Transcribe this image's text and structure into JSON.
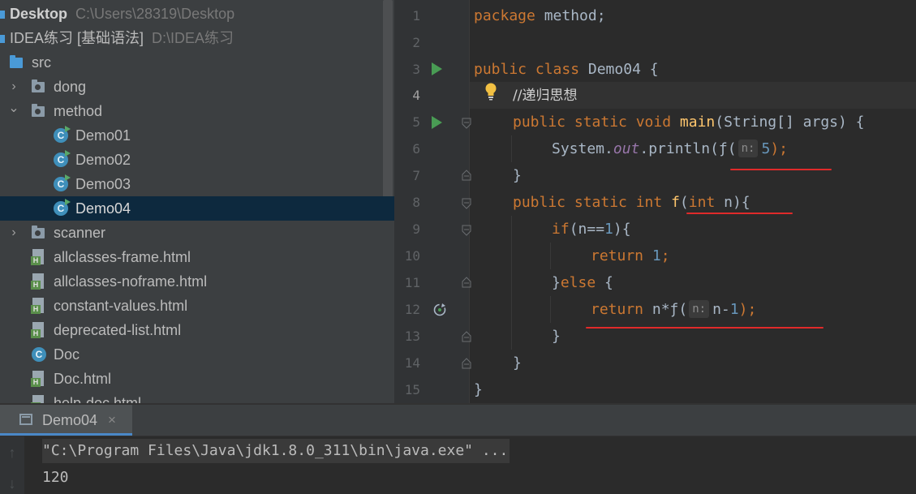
{
  "project_tree": {
    "rows": [
      {
        "label": "Desktop",
        "path": "C:\\Users\\28319\\Desktop"
      },
      {
        "label": "IDEA练习 [基础语法]",
        "path": "D:\\IDEA练习"
      },
      {
        "label": "src",
        "icon": "source-folder-icon"
      },
      {
        "label": "dong",
        "icon": "package-icon"
      },
      {
        "label": "method",
        "icon": "package-icon"
      },
      {
        "label": "Demo01",
        "icon": "java-class-icon"
      },
      {
        "label": "Demo02",
        "icon": "java-class-icon"
      },
      {
        "label": "Demo03",
        "icon": "java-class-icon"
      },
      {
        "label": "Demo04",
        "icon": "java-class-icon",
        "selected": true
      },
      {
        "label": "scanner",
        "icon": "package-icon"
      },
      {
        "label": "allclasses-frame.html",
        "icon": "html-file-icon"
      },
      {
        "label": "allclasses-noframe.html",
        "icon": "html-file-icon"
      },
      {
        "label": "constant-values.html",
        "icon": "html-file-icon"
      },
      {
        "label": "deprecated-list.html",
        "icon": "html-file-icon"
      },
      {
        "label": "Doc",
        "icon": "java-class-icon"
      },
      {
        "label": "Doc.html",
        "icon": "html-file-icon"
      },
      {
        "label": "help-doc.html",
        "icon": "html-file-icon"
      }
    ],
    "class_icon_letter": "C",
    "html_icon_letter": "H",
    "expand_arrow": "›",
    "collapse_arrow": "⌄"
  },
  "editor": {
    "line_numbers": [
      "1",
      "2",
      "3",
      "4",
      "5",
      "6",
      "7",
      "8",
      "9",
      "10",
      "11",
      "12",
      "13",
      "14",
      "15"
    ],
    "current_line": "4",
    "tokens": {
      "l1_kw": "package",
      "l1_rest": " method;",
      "l3_kw": "public class",
      "l3_rest": " Demo04 {",
      "l4_cmt": "//递归思想",
      "l5_kw": "public static void",
      "l5_fn": "main",
      "l5_rest": "(String[] args) {",
      "l6_a": "System.",
      "l6_out": "out",
      "l6_b": ".println(",
      "l6_f": "ƒ(",
      "l6_hint": "n:",
      "l6_num": "5",
      "l6_end": ");",
      "l7": "}",
      "l8_kw": "public static int",
      "l8_fn": "f",
      "l8_p": "(",
      "l8_kw2": "int",
      "l8_rest": " n){",
      "l9_kw": "if",
      "l9_a": "(n==",
      "l9_num": "1",
      "l9_b": "){",
      "l10_kw": "return",
      "l10_num": "1",
      "l10_end": ";",
      "l11_a": "}",
      "l11_kw": "else",
      "l11_b": " {",
      "l12_kw": "return",
      "l12_a": " n*",
      "l12_f": "ƒ(",
      "l12_hint": "n:",
      "l12_b": "n-",
      "l12_num": "1",
      "l12_end": ");",
      "l13": "}",
      "l14": "}",
      "l15": "}"
    }
  },
  "run_panel": {
    "tab_label": "Demo04",
    "tab_close": "×",
    "console_lines": [
      "\"C:\\Program Files\\Java\\jdk1.8.0_311\\bin\\java.exe\" ...",
      "120"
    ],
    "up_arrow": "↑",
    "down_arrow": "↓"
  },
  "colors": {
    "keyword": "#cc7832",
    "function": "#ffc66d",
    "number": "#6897bb",
    "static_field": "#9876aa",
    "annotation_underline": "#e02a2a",
    "selection": "#0d293e"
  }
}
